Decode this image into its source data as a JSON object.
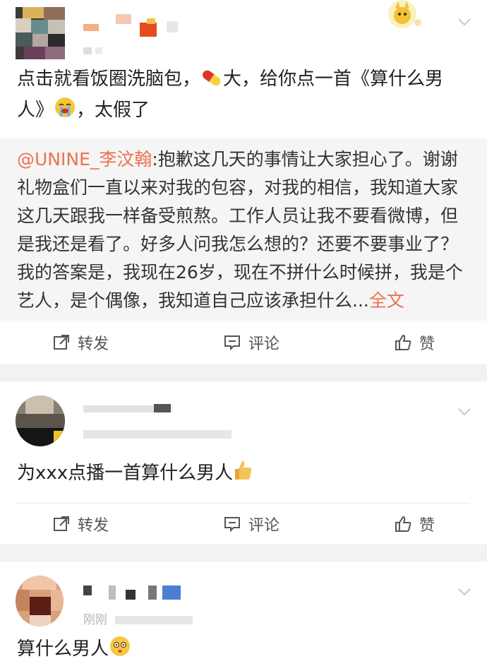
{
  "post": {
    "meta_hidden": "",
    "text_before_emoji": "点击就看饭圈洗脑包，",
    "text_after_emoji": "大，给你点一首《算什么男人》",
    "text_end": "，太假了",
    "quote": {
      "mention": "@UNINE_李汶翰",
      "body": ":抱歉这几天的事情让大家担心了。谢谢礼物盒们一直以来对我的包容，对我的相信，我知道大家这几天跟我一样备受煎熬。工作人员让我不要看微博，但是我还是看了。好多人问我怎么想的？还要不要事业了？我的答案是，我现在26岁，现在不拼什么时候拼，我是个艺人，是个偶像，我知道自己应该承担什么...",
      "more": "全文"
    },
    "actions": {
      "repost": "转发",
      "comment": "评论",
      "like": "赞"
    }
  },
  "comment1": {
    "text": "为xxx点播一首算什么男人",
    "actions": {
      "repost": "转发",
      "comment": "评论",
      "like": "赞"
    }
  },
  "comment2": {
    "meta": "刚刚",
    "text": "算什么男人"
  },
  "icons": [
    "pill-emoji",
    "crying-emoji",
    "thumbs-up-emoji",
    "flushed-emoji",
    "repost-icon",
    "comment-icon",
    "like-icon",
    "chevron-down-icon"
  ],
  "colors": {
    "link": "#eb7350",
    "quote_bg": "#f5f5f5",
    "separator": "#f2f2f2"
  }
}
